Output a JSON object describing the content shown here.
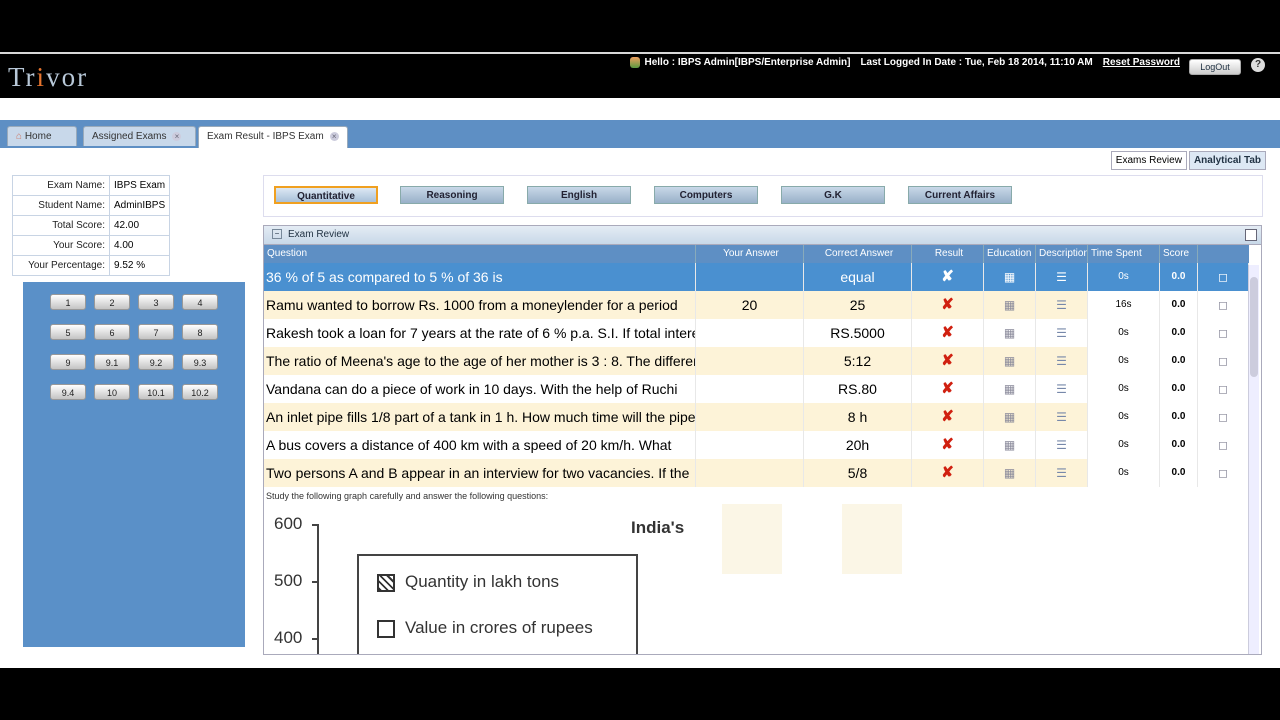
{
  "app": {
    "logo": "Trivor"
  },
  "user": {
    "greeting": "Hello : IBPS Admin[IBPS/Enterprise Admin]",
    "last_login": "Last Logged In Date : Tue, Feb 18 2014, 11:10 AM",
    "reset_password": "Reset Password",
    "logout": "LogOut"
  },
  "tabs": [
    {
      "label": "Home"
    },
    {
      "label": "Assigned Exams"
    },
    {
      "label": "Exam Result - IBPS Exam"
    }
  ],
  "right_tabs": [
    "Exams Review",
    "Analytical Tab"
  ],
  "info": [
    {
      "k": "Exam Name:",
      "v": "IBPS Exam"
    },
    {
      "k": "Student Name:",
      "v": "AdminIBPS"
    },
    {
      "k": "Total Score:",
      "v": "42.00"
    },
    {
      "k": "Your Score:",
      "v": "4.00"
    },
    {
      "k": "Your Percentage:",
      "v": "9.52 %"
    }
  ],
  "question_numbers": [
    "1",
    "2",
    "3",
    "4",
    "5",
    "6",
    "7",
    "8",
    "9",
    "9.1",
    "9.2",
    "9.3",
    "9.4",
    "10",
    "10.1",
    "10.2"
  ],
  "subjects": [
    "Quantitative",
    "Reasoning",
    "English",
    "Computers",
    "G.K",
    "Current Affairs"
  ],
  "review": {
    "title": "Exam Review",
    "columns": [
      "Question",
      "Your Answer",
      "Correct Answer",
      "Result",
      "Education",
      "Description",
      "Time Spent",
      "Score"
    ],
    "rows": [
      {
        "q": "36 % of 5 as compared to 5 % of 36 is",
        "ya": "",
        "ca": "equal",
        "ts": "0s",
        "sc": "0.0"
      },
      {
        "q": "Ramu wanted to borrow Rs. 1000 from a moneylender for a period",
        "ya": "20",
        "ca": "25",
        "ts": "16s",
        "sc": "0.0"
      },
      {
        "q": "Rakesh took a loan for 7 years at the rate of 6 % p.a. S.I. If total interest",
        "ya": "",
        "ca": "RS.5000",
        "ts": "0s",
        "sc": "0.0"
      },
      {
        "q": "The ratio of Meena's age to the age of her mother is 3 : 8. The difference",
        "ya": "",
        "ca": "5:12",
        "ts": "0s",
        "sc": "0.0"
      },
      {
        "q": "Vandana can do a piece of work in 10 days. With the help of Ruchi",
        "ya": "",
        "ca": "RS.80",
        "ts": "0s",
        "sc": "0.0"
      },
      {
        "q": "An inlet pipe fills 1/8 part of a tank in 1 h. How much time will the pipe",
        "ya": "",
        "ca": "8 h",
        "ts": "0s",
        "sc": "0.0"
      },
      {
        "q": "A bus covers a distance of 400 km with a speed of 20 km/h. What",
        "ya": "",
        "ca": "20h",
        "ts": "0s",
        "sc": "0.0"
      },
      {
        "q": "Two persons A and B appear in an interview for two vacancies. If the",
        "ya": "",
        "ca": "5/8",
        "ts": "0s",
        "sc": "0.0"
      }
    ],
    "graph_note": "Study the following graph carefully and answer the following questions:",
    "graph": {
      "title": "India's",
      "y_ticks": [
        "600",
        "500",
        "400"
      ],
      "legend": [
        "Quantity in lakh tons",
        "Value in crores of rupees"
      ]
    }
  }
}
